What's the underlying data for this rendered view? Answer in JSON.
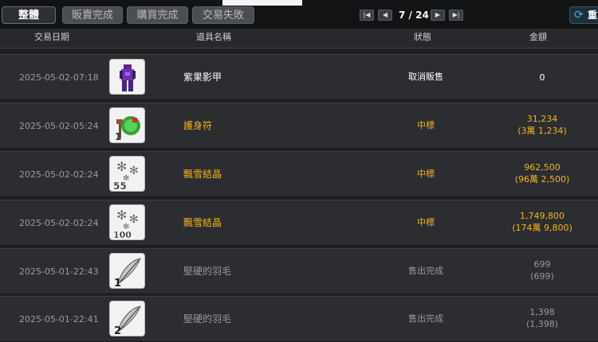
{
  "tabs": [
    {
      "label": "整體"
    },
    {
      "label": "販賣完成"
    },
    {
      "label": "購買完成"
    },
    {
      "label": "交易失敗"
    }
  ],
  "pager": {
    "text": "7 / 24"
  },
  "refresh": {
    "label": "重"
  },
  "columns": [
    "交易日期",
    "道具名稱",
    "狀態",
    "金額"
  ],
  "rows": [
    {
      "date": "2025-05-02-07:18",
      "icon": "purple-armor-icon",
      "name": "紫果影甲",
      "status": "取消販售",
      "amount": "0",
      "amount_detail": "",
      "tone": "white"
    },
    {
      "date": "2025-05-02-05:24",
      "icon": "amulet-icon",
      "name": "護身符",
      "status": "中標",
      "amount": "31,234",
      "amount_detail": "(3萬 1,234)",
      "tone": "gold"
    },
    {
      "date": "2025-05-02-02:24",
      "icon": "snow-crystal-icon",
      "quantity": "55",
      "name": "飄雪結晶",
      "status": "中標",
      "amount": "962,500",
      "amount_detail": "(96萬 2,500)",
      "tone": "gold"
    },
    {
      "date": "2025-05-02-02:24",
      "icon": "snow-crystal-icon",
      "quantity": "100",
      "name": "飄雪結晶",
      "status": "中標",
      "amount": "1,749,800",
      "amount_detail": "(174萬 9,800)",
      "tone": "gold"
    },
    {
      "date": "2025-05-01-22:43",
      "icon": "feather-icon",
      "quantity": "1",
      "name": "堅硬的羽毛",
      "status": "售出完成",
      "amount": "699",
      "amount_detail": "(699)",
      "tone": "grey"
    },
    {
      "date": "2025-05-01-22:41",
      "icon": "feather-icon",
      "quantity": "2",
      "name": "堅硬的羽毛",
      "status": "售出完成",
      "amount": "1,398",
      "amount_detail": "(1,398)",
      "tone": "grey"
    }
  ],
  "colors": {
    "gold": "#f2b419",
    "accent": "#32b2e6",
    "background": "#1e1f21"
  }
}
